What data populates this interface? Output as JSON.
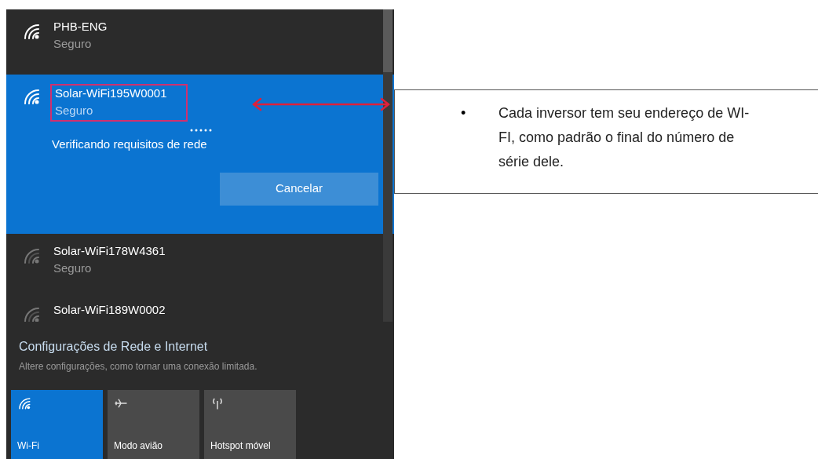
{
  "networks": [
    {
      "name": "PHB-ENG",
      "status": "Seguro",
      "selected": false,
      "weak": false
    },
    {
      "name": "Solar-WiFi195W0001",
      "status": "Seguro",
      "selected": true,
      "weak": false,
      "progress": "Verificando requisitos de rede",
      "button": "Cancelar"
    },
    {
      "name": "Solar-WiFi178W4361",
      "status": "Seguro",
      "selected": false,
      "weak": true
    },
    {
      "name": "Solar-WiFi189W0002",
      "selected": false,
      "weak": true
    }
  ],
  "settings": {
    "title": "Configurações de Rede e Internet",
    "subtitle": "Altere configurações, como tornar uma conexão limitada."
  },
  "tiles": [
    {
      "kind": "wifi",
      "label": "Wi-Fi",
      "on": true
    },
    {
      "kind": "airplane",
      "label": "Modo avião",
      "on": false
    },
    {
      "kind": "hotspot",
      "label": "Hotspot móvel",
      "on": false
    }
  ],
  "note": {
    "bullet": "•",
    "text": "Cada inversor tem seu endereço de WI-FI, como padrão o final do número de série dele."
  }
}
